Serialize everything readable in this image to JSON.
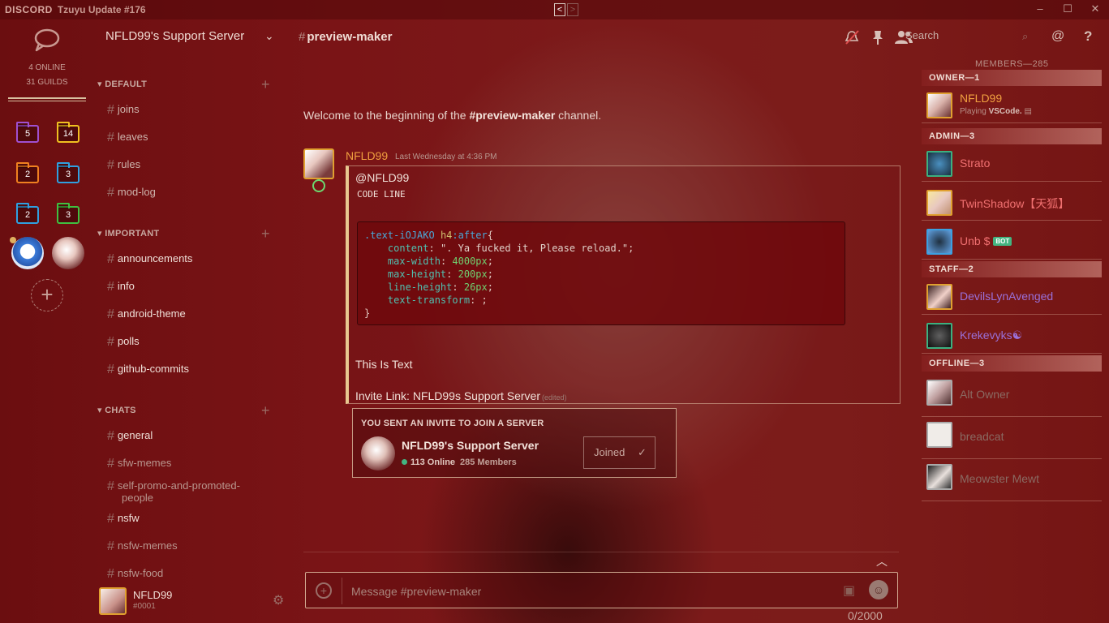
{
  "titlebar": {
    "brand": "DISCORD",
    "version": "Tzuyu Update #176",
    "back": "<",
    "forward": ">",
    "minimize": "–",
    "maximize": "☐",
    "close": "✕"
  },
  "guilds": {
    "online": "4 ONLINE",
    "guild_count": "31 GUILDS",
    "folders": [
      {
        "count": "5",
        "color": "#a050d0"
      },
      {
        "count": "14",
        "color": "#f0c020"
      },
      {
        "count": "2",
        "color": "#f08020"
      },
      {
        "count": "3",
        "color": "#30a0e0"
      },
      {
        "count": "2",
        "color": "#30a0e0"
      },
      {
        "count": "3",
        "color": "#40c040"
      }
    ],
    "add": "+"
  },
  "server": {
    "name": "NFLD99's Support Server",
    "categories": [
      {
        "name": "DEFAULT",
        "channels": [
          "joins",
          "leaves",
          "rules",
          "mod-log"
        ]
      },
      {
        "name": "IMPORTANT",
        "channels": [
          "announcements",
          "info",
          "android-theme",
          "polls",
          "github-commits"
        ]
      },
      {
        "name": "CHATS",
        "channels": [
          "general",
          "sfw-memes",
          "self-promo-and-promoted-people",
          "nsfw",
          "nsfw-memes",
          "nsfw-food"
        ]
      }
    ]
  },
  "user": {
    "name": "NFLD99",
    "tag": "#0001"
  },
  "channel": {
    "name": "preview-maker",
    "search_placeholder": "Search"
  },
  "welcome": {
    "prefix": "Welcome to the beginning of the ",
    "channel": "#preview-maker",
    "suffix": " channel."
  },
  "message": {
    "author": "NFLD99",
    "timestamp": "Last Wednesday at 4:36 PM",
    "mention": "@NFLD99",
    "code_line": "CODE LINE",
    "code": {
      "selector": ".text-iOJAKO",
      "tag": "h4",
      "pseudo": ":after",
      "content_prop": "content",
      "content_val": "\". Ya fucked it, Please reload.\"",
      "maxw_prop": "max-width",
      "maxw_val": "4000px",
      "maxh_prop": "max-height",
      "maxh_val": "200px",
      "lh_prop": "line-height",
      "lh_val": "26px",
      "tt_prop": "text-transform",
      "tt_val": ";"
    },
    "text": "This Is Text",
    "invite_link": "Invite Link: NFLD99s Support Server",
    "edited": "(edited)"
  },
  "invite": {
    "heading": "YOU SENT AN INVITE TO JOIN A SERVER",
    "server_name": "NFLD99's Support Server",
    "online": "113 Online",
    "members": "285 Members",
    "button": "Joined",
    "check": "✓"
  },
  "composer": {
    "placeholder": "Message #preview-maker",
    "count": "0/2000",
    "plus": "+"
  },
  "members": {
    "title": "MEMBERS—285",
    "groups": [
      {
        "role": "OWNER—1",
        "people": [
          {
            "name": "NFLD99",
            "color": "#f0a040",
            "sub_prefix": "Playing ",
            "sub_game": "VSCode."
          }
        ]
      },
      {
        "role": "ADMIN—3",
        "people": [
          {
            "name": "Strato",
            "color": "#f07070"
          },
          {
            "name": "TwinShadow【天狐】",
            "color": "#f07070"
          },
          {
            "name": "Unb $",
            "color": "#f07070",
            "bot": "BOT"
          }
        ]
      },
      {
        "role": "STAFF—2",
        "people": [
          {
            "name": "DevilsLynAvenged",
            "color": "#9a70d8"
          },
          {
            "name": "Krekevyks☯",
            "color": "#9a70d8"
          }
        ]
      },
      {
        "role": "OFFLINE—3",
        "people": [
          {
            "name": "Alt Owner",
            "color": "#8a6a62"
          },
          {
            "name": "breadcat",
            "color": "#8a6a62"
          },
          {
            "name": "Meowster Mewt",
            "color": "#8a6a62"
          }
        ]
      }
    ]
  }
}
